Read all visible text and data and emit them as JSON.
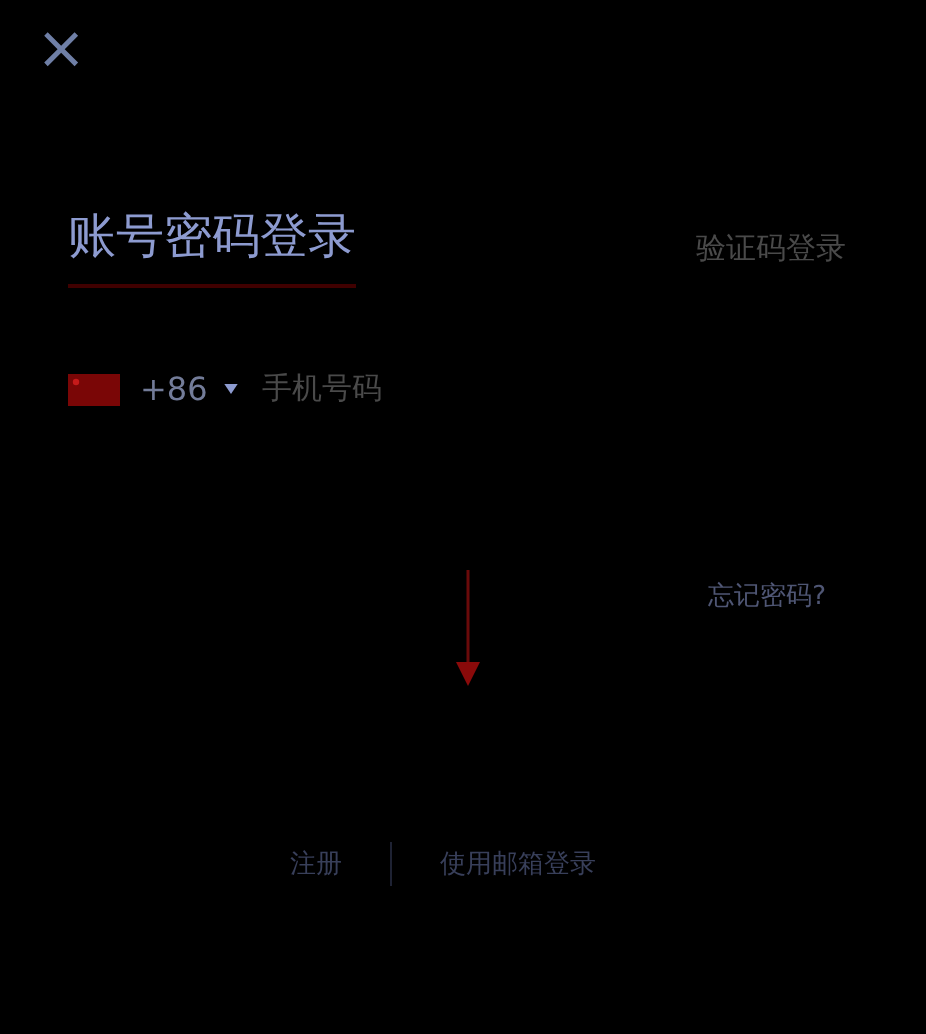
{
  "close": {
    "label": "×"
  },
  "tabs": [
    {
      "label": "账号密码登录",
      "selected": true
    },
    {
      "label": "验证码登录",
      "selected": false
    }
  ],
  "phone": {
    "country_code": "+86",
    "placeholder": "手机号码"
  },
  "forgot_link": "忘记密码?",
  "footer_links": [
    {
      "label": "注册"
    },
    {
      "label": "使用邮箱登录"
    }
  ]
}
